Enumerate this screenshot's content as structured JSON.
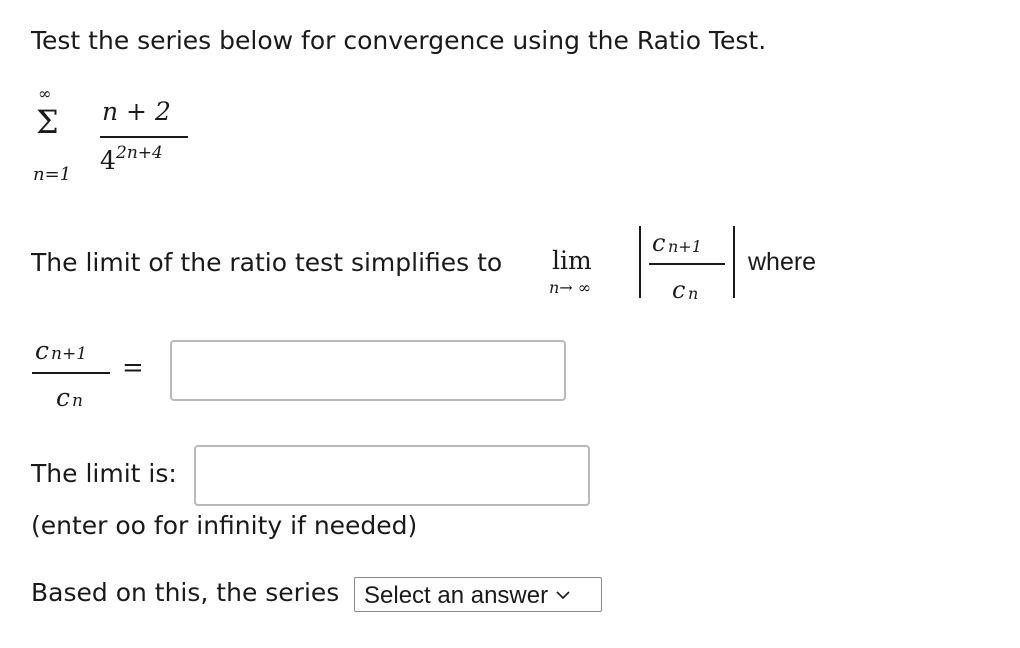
{
  "question": {
    "prompt": "Test the series below for convergence using the Ratio Test."
  },
  "series": {
    "sigma": "Σ",
    "upper": "∞",
    "lower": "n=1",
    "numerator": "n + 2",
    "denominator_base": "4",
    "denominator_exponent": "2n+4"
  },
  "ratio_statement": {
    "text": "The limit of the ratio test simplifies to",
    "lim": "lim",
    "lim_sub": "n→ ∞",
    "frac_numerator": "c",
    "frac_numerator_sub": "n+1",
    "frac_denominator": "c",
    "frac_denominator_sub": "n",
    "after": "where"
  },
  "ratio_field": {
    "numerator": "c",
    "numerator_sub": "n+1",
    "denominator": "c",
    "denominator_sub": "n",
    "equals": "=",
    "value": ""
  },
  "limit_field": {
    "label": "The limit is:",
    "value": "",
    "hint": "(enter oo for infinity if needed)"
  },
  "conclusion": {
    "text": "Based on this, the series",
    "select_label": "Select an answer"
  }
}
